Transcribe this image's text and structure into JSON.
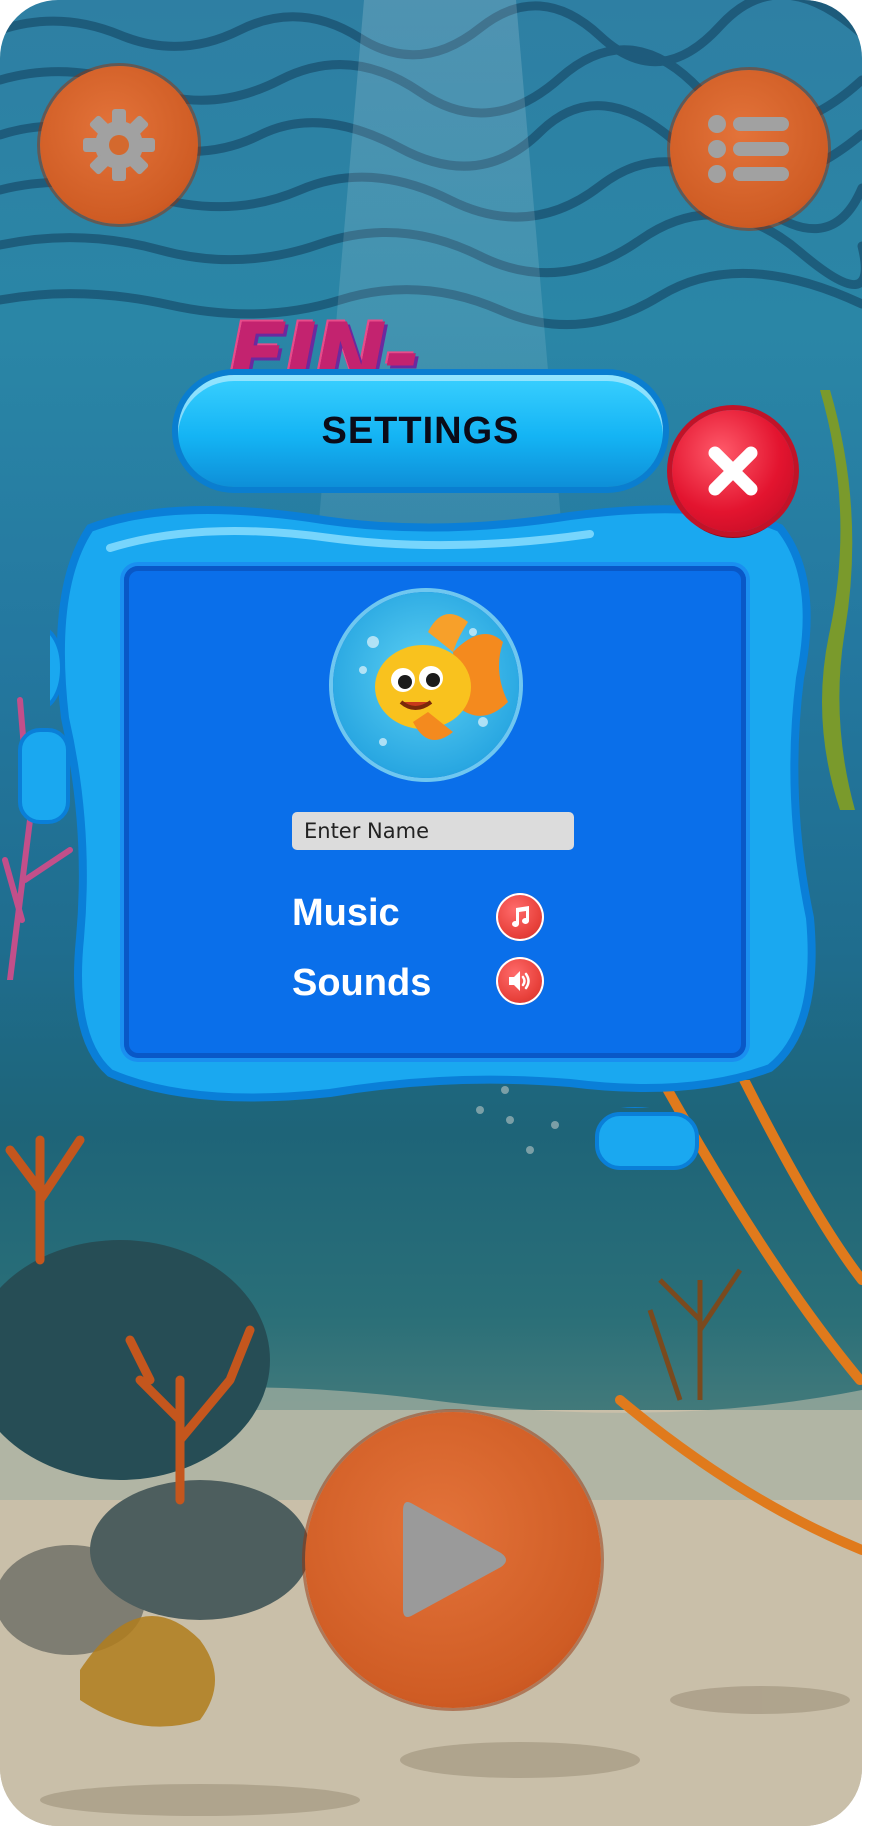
{
  "game": {
    "title_logo": "FIN-TASTIC"
  },
  "dialog": {
    "title": "SETTINGS",
    "name_input": {
      "placeholder": "Enter Name",
      "value": ""
    },
    "options": {
      "music": {
        "label": "Music",
        "icon": "music-note-icon",
        "enabled": true
      },
      "sounds": {
        "label": "Sounds",
        "icon": "speaker-icon",
        "enabled": true
      }
    },
    "avatar": {
      "icon": "goldfish-avatar"
    }
  },
  "buttons": {
    "settings": {
      "icon": "gear-icon"
    },
    "menu": {
      "icon": "list-menu-icon"
    },
    "close": {
      "icon": "close-icon"
    },
    "play": {
      "icon": "play-icon"
    }
  },
  "colors": {
    "orange_button": "#cf5c24",
    "dialog_blue": "#0a6fea",
    "header_cyan": "#14b4f4",
    "close_red": "#e3142f",
    "toggle_red": "#e8413b",
    "logo_magenta": "#c3236f"
  }
}
